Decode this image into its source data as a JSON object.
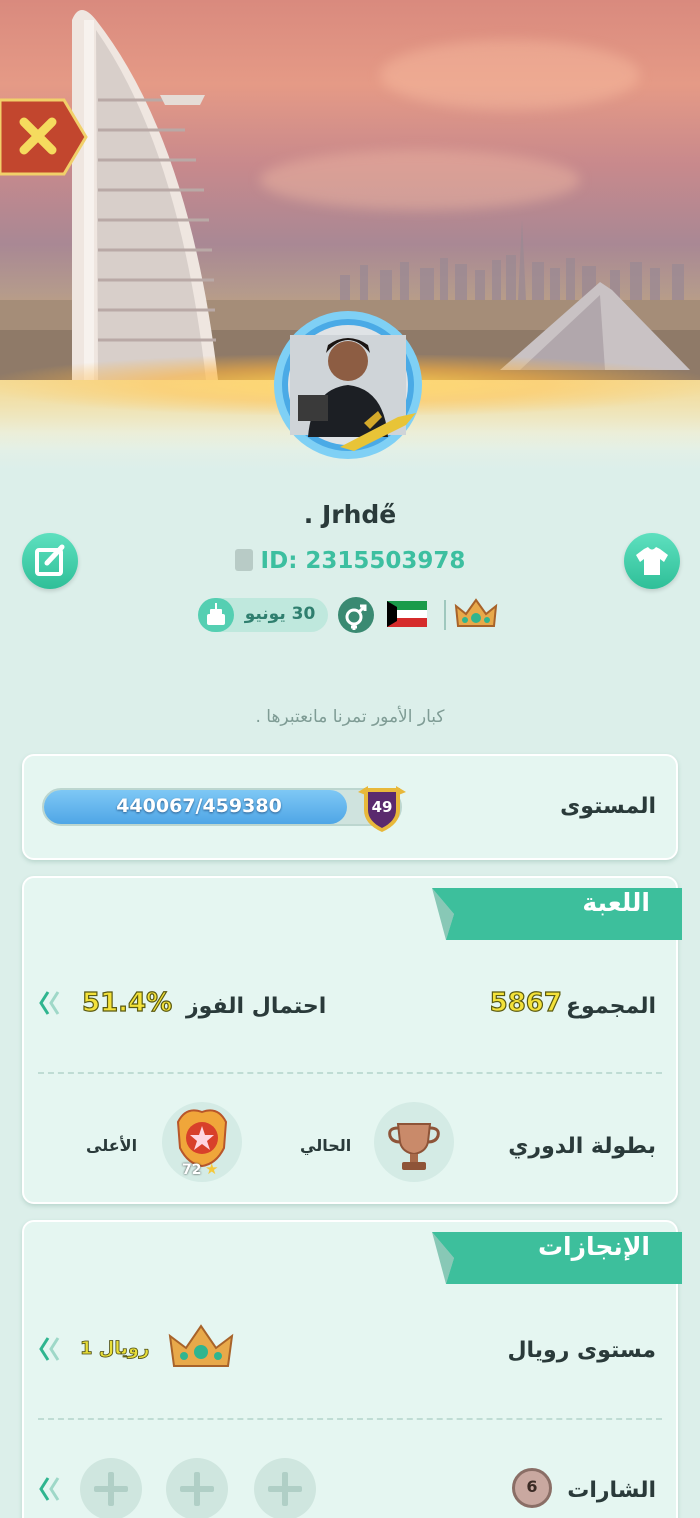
{
  "profile": {
    "name": ". Jrhde̋",
    "id_label": "ID: 2315503978",
    "birthday": "30 يونيو",
    "bio": "كبار الأمور تمرنا مانعتبرها ."
  },
  "level": {
    "label": "المستوى",
    "progress_text": "440067/459380",
    "level_number": "49",
    "progress_fraction": 0.958
  },
  "game": {
    "title": "اللعبة",
    "total_label": "المجموع",
    "total_value": "5867",
    "win_label": "احتمال الفوز",
    "win_value": "51.4%",
    "league_label": "بطولة الدوري",
    "current_label": "الحالي",
    "highest_label": "الأعلى",
    "highest_stars": "72"
  },
  "achievements": {
    "title": "الإنجازات",
    "royal_label": "مستوى رويال",
    "royal_value": "رويال 1",
    "badges_label": "الشارات",
    "badges_count": "6"
  },
  "colors": {
    "accent": "#3dbfa0",
    "value_yellow": "#f4e23a",
    "progress_blue": "#4fa6e6"
  },
  "icons": [
    "close-icon",
    "edit-icon",
    "shirt-icon",
    "document-icon",
    "cake-icon",
    "gender-icon",
    "kuwait-flag-icon",
    "crown-icon",
    "level-shield-icon",
    "trophy-icon",
    "league-emblem-icon",
    "chevron-left-icon",
    "plus-icon"
  ]
}
